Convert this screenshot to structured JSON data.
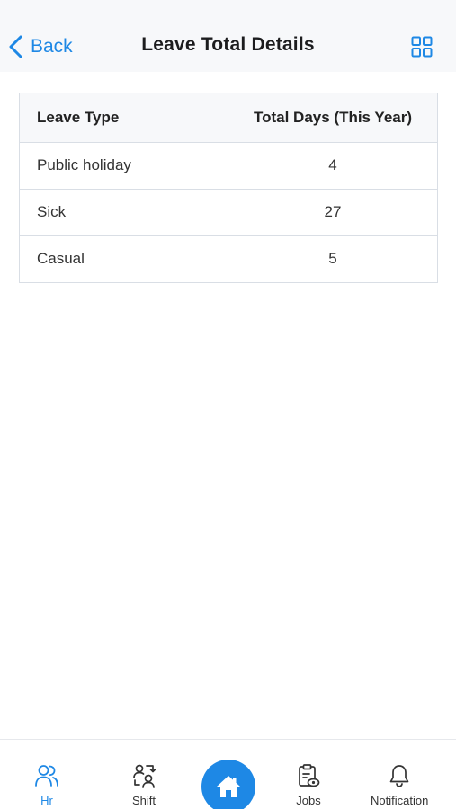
{
  "header": {
    "back_label": "Back",
    "title": "Leave Total Details",
    "accent_color": "#1e88e5"
  },
  "table": {
    "headers": [
      "Leave Type",
      "Total Days (This Year)"
    ],
    "rows": [
      {
        "type": "Public holiday",
        "days": "4"
      },
      {
        "type": "Sick",
        "days": "27"
      },
      {
        "type": "Casual",
        "days": "5"
      }
    ]
  },
  "bottom_nav": {
    "items": [
      {
        "label": "Hr",
        "icon": "users-icon",
        "active": true
      },
      {
        "label": "Shift",
        "icon": "user-swap-icon",
        "active": false
      },
      {
        "label": "",
        "icon": "home-icon",
        "active": false
      },
      {
        "label": "Jobs",
        "icon": "clipboard-eye-icon",
        "active": false
      },
      {
        "label": "Notification",
        "icon": "bell-icon",
        "active": false
      }
    ]
  }
}
